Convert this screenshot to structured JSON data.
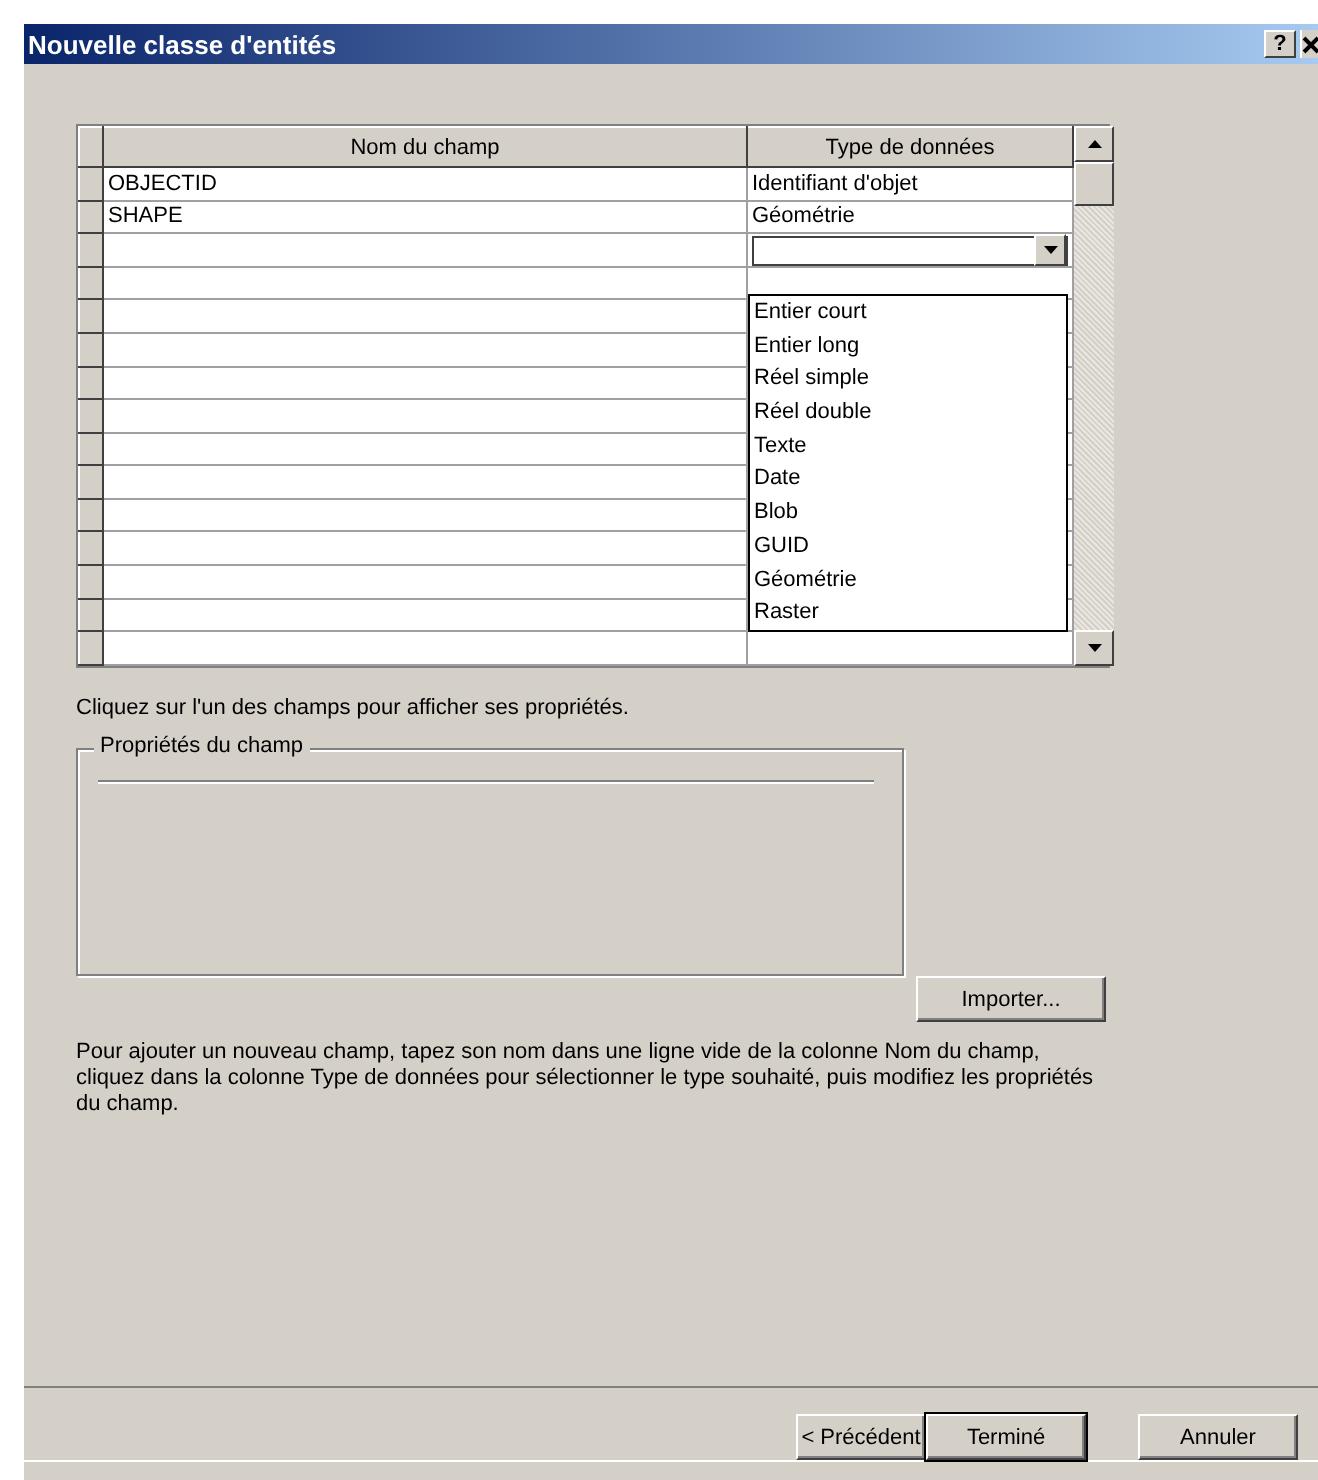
{
  "window": {
    "title": "Nouvelle classe d'entités",
    "help_button": "?"
  },
  "grid": {
    "columns": [
      "Nom du champ",
      "Type de données"
    ],
    "rows": [
      {
        "name": "OBJECTID",
        "type": "Identifiant d'objet"
      },
      {
        "name": "SHAPE",
        "type": "Géométrie"
      }
    ],
    "type_dropdown": {
      "expanded": true,
      "options": [
        "Entier court",
        "Entier long",
        "Réel simple",
        "Réel double",
        "Texte",
        "Date",
        "Blob",
        "GUID",
        "Géométrie",
        "Raster"
      ]
    }
  },
  "hint": "Cliquez sur l'un des champs pour afficher ses propriétés.",
  "properties_group": {
    "title": "Propriétés du champ"
  },
  "import_button": "Importer...",
  "instructions": "Pour ajouter un nouveau champ, tapez son nom dans une ligne vide de la colonne Nom du champ, cliquez dans la colonne Type de données pour sélectionner le type souhaité, puis modifiez les propriétés du champ.",
  "buttons": [
    {
      "label": "< Précédent",
      "default": false
    },
    {
      "label": "Terminé",
      "default": true
    },
    {
      "label": "Annuler",
      "default": false
    }
  ]
}
